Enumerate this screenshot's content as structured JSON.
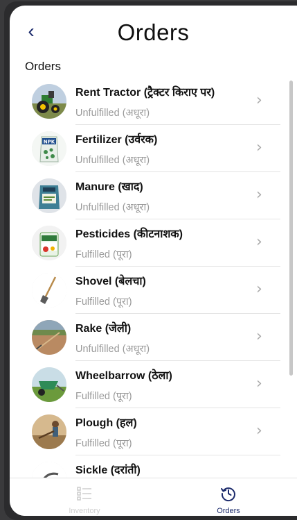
{
  "header": {
    "title": "Orders",
    "back_icon": "chevron-left-icon"
  },
  "section": {
    "title": "Orders"
  },
  "orders": [
    {
      "title": "Rent Tractor (ट्रैक्टर किराए पर)",
      "status": "Unfulfilled (अधूरा)",
      "image": "tractor"
    },
    {
      "title": "Fertilizer (उर्वरक)",
      "status": "Unfulfilled (अधूरा)",
      "image": "fertilizer"
    },
    {
      "title": "Manure (खाद)",
      "status": "Unfulfilled (अधूरा)",
      "image": "manure"
    },
    {
      "title": "Pesticides (कीटनाशक)",
      "status": "Fulfilled (पूरा)",
      "image": "pesticide"
    },
    {
      "title": "Shovel (बेलचा)",
      "status": "Fulfilled (पूरा)",
      "image": "shovel"
    },
    {
      "title": "Rake (जेली)",
      "status": "Unfulfilled (अधूरा)",
      "image": "rake"
    },
    {
      "title": "Wheelbarrow (ठेला)",
      "status": "Fulfilled (पूरा)",
      "image": "wheelbarrow"
    },
    {
      "title": "Plough (हल)",
      "status": "Fulfilled (पूरा)",
      "image": "plough"
    },
    {
      "title": "Sickle (दरांती)",
      "status": "",
      "image": "sickle"
    }
  ],
  "tabs": [
    {
      "label": "Inventory",
      "icon": "list-icon",
      "active": false
    },
    {
      "label": "Orders",
      "icon": "history-clock-icon",
      "active": true
    }
  ],
  "colors": {
    "accent": "#1b2a6b",
    "status_text": "#9a9a9a",
    "inactive_tab": "#cfcfcf"
  }
}
